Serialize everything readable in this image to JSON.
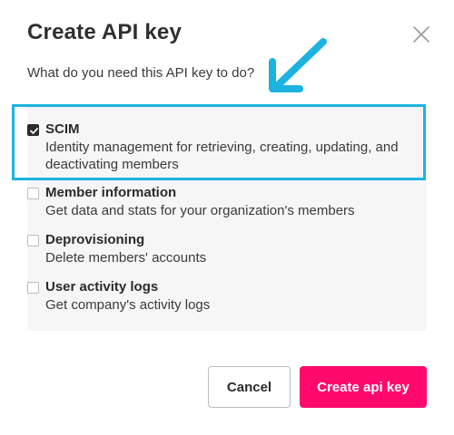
{
  "dialog": {
    "title": "Create API key",
    "subtitle": "What do you need this API key to do?",
    "options": [
      {
        "title": "SCIM",
        "description": "Identity management for retrieving, creating, updating, and deactivating members",
        "checked": true
      },
      {
        "title": "Member information",
        "description": "Get data and stats for your organization's members",
        "checked": false
      },
      {
        "title": "Deprovisioning",
        "description": "Delete members' accounts",
        "checked": false
      },
      {
        "title": "User activity logs",
        "description": "Get company's activity logs",
        "checked": false
      }
    ],
    "cancel_label": "Cancel",
    "create_label": "Create api key"
  },
  "colors": {
    "accent": "#ff0a6c",
    "highlight": "#1cb3e0",
    "panel_bg": "#f6f6f6"
  },
  "icons": {
    "close": "close-icon",
    "check": "check-icon",
    "annotation_arrow": "arrow-icon"
  }
}
